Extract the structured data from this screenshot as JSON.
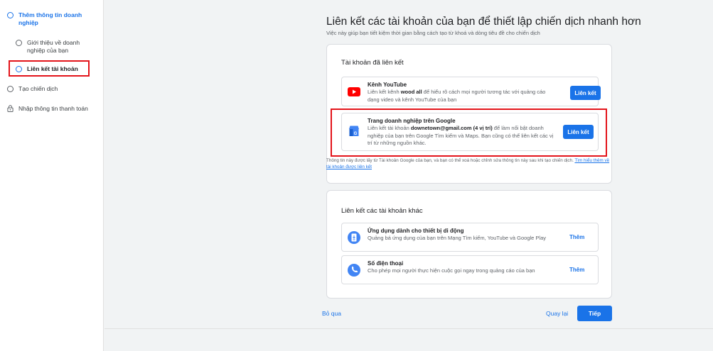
{
  "sidebar": {
    "steps": [
      {
        "label": "Thêm thông tin doanh nghiệp",
        "icon": "circle-icon"
      },
      {
        "label": "Giới thiệu về doanh nghiệp của bạn",
        "icon": "circle-icon"
      },
      {
        "label": "Liên kết tài khoản",
        "icon": "circle-icon"
      },
      {
        "label": "Tạo chiến dịch",
        "icon": "circle-icon"
      },
      {
        "label": "Nhập thông tin thanh toán",
        "icon": "lock-icon"
      }
    ]
  },
  "main": {
    "title": "Liên kết các tài khoản của bạn để thiết lập chiến dịch nhanh hơn",
    "subtitle": "Việc này giúp bạn tiết kiệm thời gian bằng cách tạo từ khoá và dòng tiêu đề cho chiến dịch"
  },
  "linked_card": {
    "title": "Tài khoản đã liên kết",
    "youtube": {
      "icon": "youtube-icon",
      "title": "Kênh YouTube",
      "desc_pre": "Liên kết kênh ",
      "desc_bold": "wood all",
      "desc_post": " để hiểu rõ cách mọi người tương tác với quảng cáo dạng video và kênh YouTube của bạn",
      "button": "Liên kết"
    },
    "gbp": {
      "icon": "google-business-icon",
      "title": "Trang doanh nghiệp trên Google",
      "desc_pre": "Liên kết tài khoản ",
      "desc_bold": "downetown@gmail.com (4 vị trí)",
      "desc_post": " để làm nổi bật doanh nghiệp của bạn trên Google Tìm kiếm và Maps. Bạn cũng có thể liên kết các vị trí từ những nguồn khác.",
      "button": "Liên kết"
    },
    "note_text": "Thông tin này được lấy từ Tài khoản Google của bạn, và bạn có thể xoá hoặc chỉnh sửa thông tin này sau khi tạo chiến dịch. ",
    "note_link": "Tìm hiểu thêm về tài khoản được liên kết"
  },
  "other_card": {
    "title": "Liên kết các tài khoản khác",
    "app": {
      "icon": "mobile-app-icon",
      "title": "Ứng dụng dành cho thiết bị di động",
      "desc": "Quảng bá ứng dụng của bạn trên Mạng Tìm kiếm, YouTube và Google Play",
      "button": "Thêm"
    },
    "phone": {
      "icon": "phone-icon",
      "title": "Số điện thoại",
      "desc": "Cho phép mọi người thực hiện cuộc gọi ngay trong quảng cáo của bạn",
      "button": "Thêm"
    }
  },
  "footer": {
    "skip": "Bỏ qua",
    "back": "Quay lại",
    "next": "Tiếp"
  },
  "colors": {
    "accent": "#1a73e8",
    "highlight": "#e3141a",
    "youtube": "#ff0000"
  }
}
